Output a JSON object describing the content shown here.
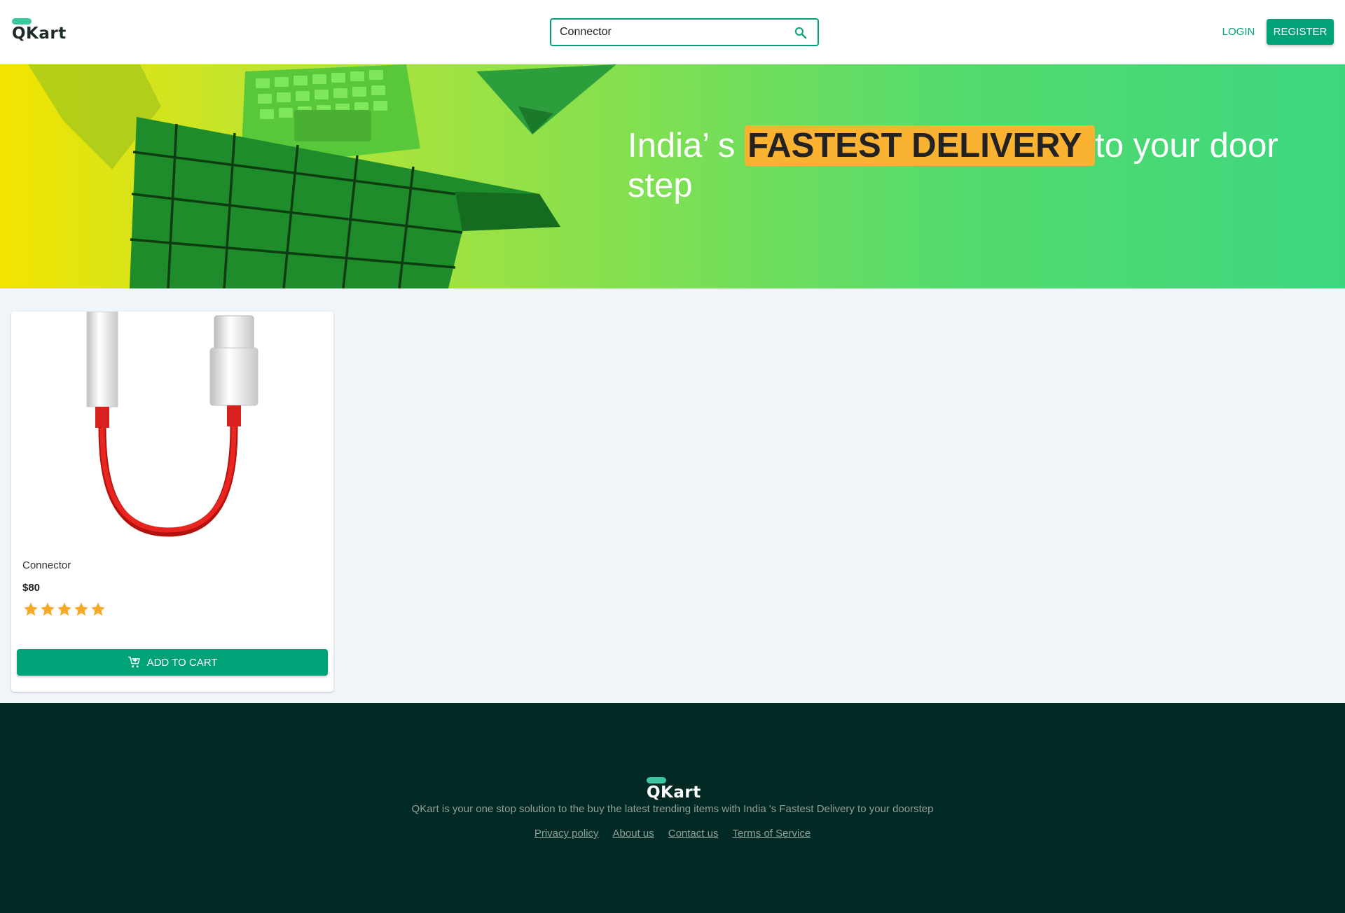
{
  "header": {
    "logo_text": "QKart",
    "search": {
      "value": "Connector",
      "icon": "search-icon"
    },
    "login_label": "LOGIN",
    "register_label": "REGISTER"
  },
  "hero": {
    "text_before": "India’ s ",
    "highlight": "FASTEST DELIVERY ",
    "text_after": "to your door step",
    "highlight_color": "#f9b232"
  },
  "products": [
    {
      "name": "Connector",
      "price": "$80",
      "rating": 5,
      "rating_max": 5,
      "add_to_cart_label": "ADD TO CART",
      "cart_icon": "add-shopping-cart-icon"
    }
  ],
  "footer": {
    "logo_text": "QKart",
    "description": "QKart is your one stop solution to the buy the latest trending items with India 's Fastest Delivery to your doorstep",
    "links": [
      "Privacy policy",
      "About us",
      "Contact us",
      "Terms of Service"
    ]
  },
  "colors": {
    "accent": "#00a278",
    "logo_accent": "#3cc7a0",
    "footer_bg": "#032924",
    "star": "#f9a825"
  }
}
